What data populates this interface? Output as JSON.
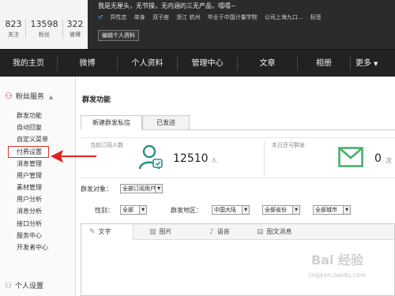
{
  "header": {
    "stats": [
      {
        "num": "823",
        "label": "关注"
      },
      {
        "num": "13598",
        "label": "粉丝"
      },
      {
        "num": "322",
        "label": "微博"
      }
    ],
    "tagline": "我是无厘头，无节操，无内涵的三无产品，嘻嘻~",
    "gender_symbol": "♂",
    "info": [
      "异性恋",
      "单身",
      "双子座",
      "浙江 杭州",
      "毕业于中国计量学院",
      "公司上海九口...",
      "标签"
    ],
    "edit_button": "编辑个人资料"
  },
  "nav": [
    "我的主页",
    "微博",
    "个人资料",
    "管理中心",
    "文章",
    "相册",
    "更多"
  ],
  "sidebar": {
    "section_title": "粉丝服务",
    "items": [
      "群发功能",
      "自动回复",
      "自定义菜单",
      "付费设置",
      "消息管理",
      "用户管理",
      "素材管理",
      "用户分析",
      "消息分析",
      "接口分析",
      "服务中心",
      "开发者中心"
    ],
    "active_index": 3,
    "section2_title": "个人设置"
  },
  "main": {
    "title": "群发功能",
    "tabs": [
      "新建群发私信",
      "已发送"
    ],
    "subscribers_label": "当前订阅人数",
    "subscribers_count": "12510",
    "subscribers_unit": "人",
    "remaining_label": "本日还可群发",
    "remaining_count": "0",
    "remaining_unit": "次",
    "target_label": "群发对象：",
    "target_value": "全部订阅用户",
    "gender_label": "性别：",
    "gender_value": "全部",
    "region_label": "群发地区：",
    "country_value": "中国大陆",
    "province_value": "全部省份",
    "city_value": "全部城市",
    "editor_tabs": [
      "文字",
      "图片",
      "语音",
      "图文消息"
    ]
  },
  "watermark": {
    "line1": "Bai 经验",
    "url": "jingyan.baidu.com"
  },
  "colors": {
    "accent": "#d9342b",
    "nav_bg": "#222222",
    "icon_teal": "#2e8a8a",
    "icon_green": "#46b06a"
  }
}
